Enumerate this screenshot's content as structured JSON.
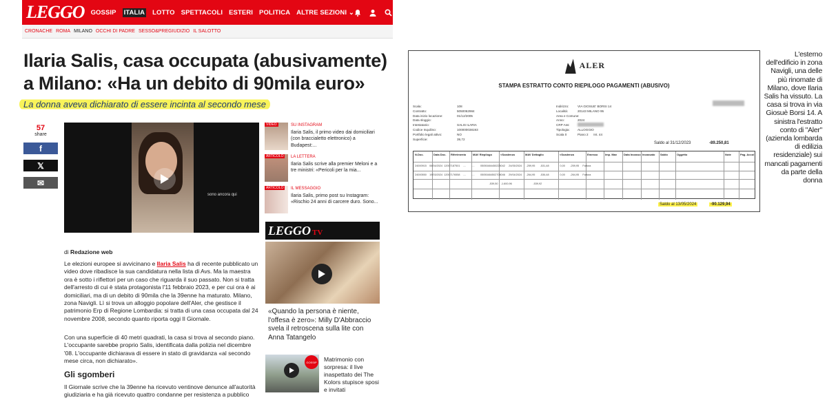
{
  "nav": {
    "logo": "LEGGO",
    "items": [
      "GOSSIP",
      "ITALIA",
      "LOTTO",
      "SPETTACOLI",
      "ESTERI",
      "POLITICA",
      "ALTRE SEZIONI"
    ],
    "active": "ITALIA",
    "icons": [
      "bell-icon",
      "user-icon",
      "search-icon"
    ]
  },
  "subnav": [
    "CRONACHE",
    "ROMA",
    "MILANO",
    "OCCHI DI PADRE",
    "SESSO&PREGIUDIZIO",
    "IL SALOTTO"
  ],
  "article": {
    "headline": "Ilaria Salis, casa occupata (abusivamente) a Milano: «Ha un debito di 90mila euro»",
    "subtitle": "La donna aveva dichiarato di essere incinta al secondo mese",
    "share_count": "57",
    "share_label": "share",
    "video_caption": "sono ancora qui",
    "byline_prefix": "di",
    "byline_author": "Redazione web",
    "p1_before": "Le elezioni europee si avvicinano e ",
    "p1_link": "Ilaria Salis",
    "p1_after": " ha di recente pubblicato un video dove ribadisce la sua candidatura nella lista di Avs. Ma la maestra ora è sotto i riflettori per un caso che riguarda il suo passato. Non si tratta dell'arresto di cui è stata protagonista l'11 febbraio 2023, e per cui ora è ai domiciliari, ma di un debito di 90mila che la 39enne ha maturato. Milano, zona Navigli. Lì si trova un alloggio popolare dell'Aler, che gestisce il patrimonio Erp di Regione Lombardia: si tratta di una casa occupata dal 24 novembre 2008, secondo quanto riporta oggi Il Giornale.",
    "p2": "Con una superficie di 40 metri quadrati, la casa si trova al secondo piano. L'occupante sarebbe proprio Salis, identificata dalla polizia nel dicembre '08. L'occupante dichiarava di essere in stato di gravidanza «al secondo mese circa, non dichiarato».",
    "section_title": "Gli sgomberi",
    "p3": "Il Giornale scrive che la 39enne ha ricevuto ventinove denunce all'autorità giudiziaria e ha già ricevuto quattro condanne per resistenza a pubblico"
  },
  "sidebar": [
    {
      "tag": "VIDEO",
      "kicker": "SU INSTAGRAM",
      "text": "Ilaria Salis, il primo video dai domiciliari (con braccialetto elettronico) a Budapest:..."
    },
    {
      "tag": "ARTICOLO",
      "kicker": "LA LETTERA",
      "text": "Ilaria Salis scrive alla premier Meloni e a tre ministri: «Pericoli per la mia..."
    },
    {
      "tag": "ARTICOLO",
      "kicker": "IL MESSAGGIO",
      "text": "Ilaria Salis, primo post su Instagram: «Rischio 24 anni di carcere duro. Sono..."
    }
  ],
  "tv": {
    "logo": "LEGGO",
    "logo_suffix": "TV",
    "caption1": "«Quando la persona è niente, l'offesa è zero»: Milly D'Abbraccio svela il retroscena sulla lite con Anna Tatangelo",
    "badge": "GOSSIP",
    "caption2": "Matrimonio con sorpresa: il live inaspettato dei The Kolors stupisce sposi e invitati"
  },
  "document": {
    "org": "ALER",
    "title": "STAMPA ESTRATTO CONTO RIEPILOGO PAGAMENTI (ABUSIVO)",
    "labels_col1": "Scala:\nContratto:\nData inizio locazione:\nData sloggio:\nIntestatario:\nCodice Inquilino:\nPortfolio legali attivo:\nSuperficie:",
    "values_col1": "108\n5050062984\n01/12/2005\n\nSALIS ILARIA\n100000038193\nNO\n39,72",
    "labels_col2": "Indirizzo:\nLocalità:\nArea e Comune:\nAnno:\nCRP Ass:\nTipologia:\nScala 0",
    "values_col2": "VIA GIOSUE' BORSI 14\n20143 MILANO 95\n\n2024\n\nALLOGGIO\nPiano 2      Int. 44",
    "saldo1_label": "Saldo al 31/12/2023",
    "saldo1_value": "-89.250,81",
    "headers": [
      "N.Doc.",
      "Data Doc.",
      "Riferimento",
      "MAV Riepilogo",
      "<Scadenza",
      "MAV Dettaglio",
      "<Scadenza",
      "Emesso",
      "Imp. Mav",
      "Data Incasso",
      "Incassato",
      "Saldo",
      "Oggetto",
      "Note",
      "Pag. Accol"
    ],
    "row1": "24000915    06/04/2024  12007187501    ....        ....        05050484450225042     24/05/2024      -259,95       -531,48               0,00       -259,95     Fattura",
    "row2": "24000550    19/03/2024  12007176558    ....        ....        05050484502708046     29/04/2024      -264,95       -536,48               0,00       -264,95     Fattura",
    "row3": "                                                                                                      -539,50    -1.600,96                             -539,92",
    "saldo2_label": "Saldo al 13/05/2024",
    "saldo2_value": "-90.129,94"
  },
  "right_caption": "L'esterno dell'edificio in zona Navigli, una delle più rinomate di Milano, dove Ilaria Salis ha vissuto. La casa si trova in via Giosuè Borsi 14. A sinistra l'estratto conto di \"Aler\" (azienda lombarda di edilizia residenziale) sui mancati pagamenti da parte della donna"
}
